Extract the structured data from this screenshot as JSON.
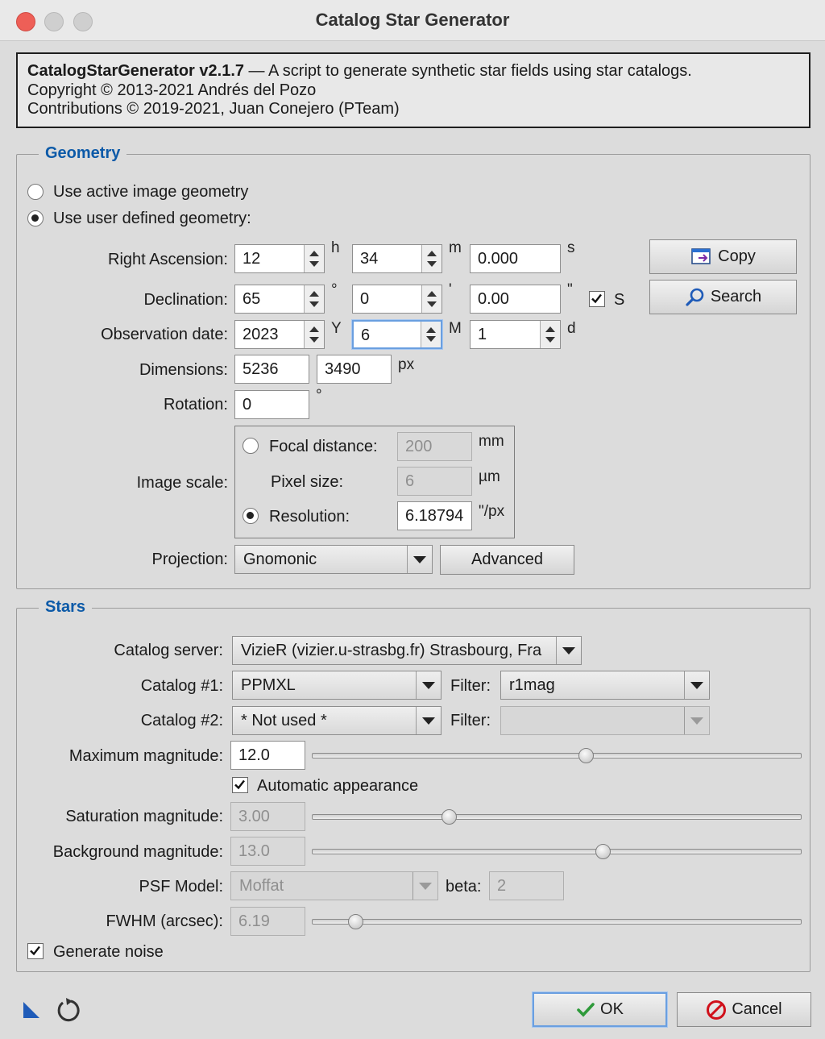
{
  "window": {
    "title": "Catalog Star Generator"
  },
  "header": {
    "script_name": "CatalogStarGenerator v2.1.7",
    "description": " — A script to generate synthetic star fields using star catalogs.",
    "copyright": "Copyright © 2013-2021 Andrés del Pozo",
    "contributions": "Contributions © 2019-2021, Juan Conejero (PTeam)"
  },
  "geometry": {
    "title": "Geometry",
    "options": {
      "active": "Use active image geometry",
      "user": "Use user defined geometry:",
      "selected": "user"
    },
    "ra": {
      "label": "Right Ascension:",
      "h": "12",
      "m": "34",
      "s": "0.000",
      "u_h": "h",
      "u_m": "m",
      "u_s": "s"
    },
    "dec": {
      "label": "Declination:",
      "deg": "65",
      "min": "0",
      "sec": "0.00",
      "u_deg": "°",
      "u_min": "'",
      "u_sec": "\"",
      "south_label": "S",
      "south_checked": true
    },
    "date": {
      "label": "Observation date:",
      "year": "2023",
      "month": "6",
      "day": "1",
      "u_y": "Y",
      "u_m": "M",
      "u_d": "d"
    },
    "dimensions": {
      "label": "Dimensions:",
      "width": "5236",
      "height": "3490",
      "unit": "px"
    },
    "rotation": {
      "label": "Rotation:",
      "value": "0",
      "unit": "°"
    },
    "scale": {
      "label": "Image scale:",
      "focal_label": "Focal distance:",
      "focal_value": "200",
      "focal_unit": "mm",
      "pixel_label": "Pixel size:",
      "pixel_value": "6",
      "pixel_unit": "µm",
      "res_label": "Resolution:",
      "res_value": "6.18794",
      "res_unit": "\"/px",
      "selected": "resolution"
    },
    "projection": {
      "label": "Projection:",
      "value": "Gnomonic",
      "advanced_label": "Advanced"
    },
    "copy_label": "Copy",
    "search_label": "Search"
  },
  "stars": {
    "title": "Stars",
    "server": {
      "label": "Catalog server:",
      "value": "VizieR (vizier.u-strasbg.fr) Strasbourg, Fra"
    },
    "catalog1": {
      "label": "Catalog #1:",
      "value": "PPMXL",
      "filter_label": "Filter:",
      "filter_value": "r1mag"
    },
    "catalog2": {
      "label": "Catalog #2:",
      "value": "* Not used *",
      "filter_label": "Filter:",
      "filter_value": ""
    },
    "max_mag": {
      "label": "Maximum magnitude:",
      "value": "12.0",
      "slider_fraction": 0.56
    },
    "auto_appearance": {
      "label": "Automatic appearance",
      "checked": true
    },
    "sat_mag": {
      "label": "Saturation magnitude:",
      "value": "3.00",
      "slider_fraction": 0.28
    },
    "bg_mag": {
      "label": "Background magnitude:",
      "value": "13.0",
      "slider_fraction": 0.595
    },
    "psf": {
      "label": "PSF Model:",
      "value": "Moffat",
      "beta_label": "beta:",
      "beta_value": "2"
    },
    "fwhm": {
      "label": "FWHM (arcsec):",
      "value": "6.19",
      "slider_fraction": 0.09
    },
    "noise": {
      "label": "Generate noise",
      "checked": true
    }
  },
  "footer": {
    "ok_label": "OK",
    "cancel_label": "Cancel"
  },
  "colors": {
    "group_title": "#0c5aa8",
    "ok_focus": "#6a9fe0",
    "cancel_red": "#d0101a",
    "check_green": "#2e9a3a"
  }
}
